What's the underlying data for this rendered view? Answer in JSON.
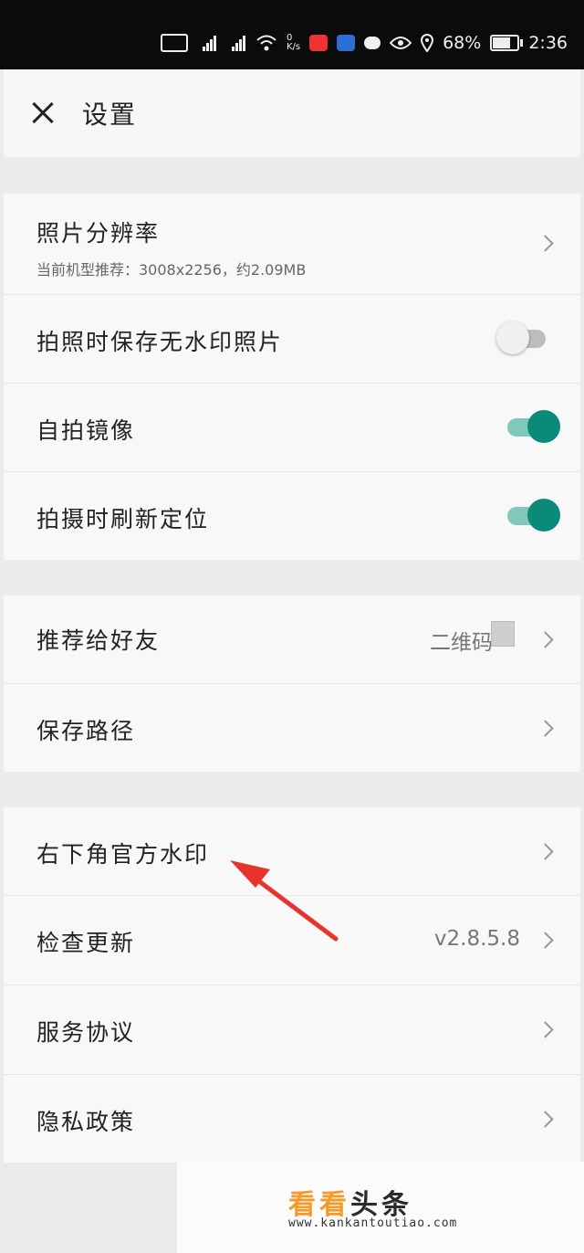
{
  "status_bar": {
    "network_speed": "0\nK/s",
    "battery_percent": "68%",
    "time": "2:36"
  },
  "header": {
    "title": "设置"
  },
  "settings": {
    "resolution": {
      "label": "照片分辨率",
      "subtitle": "当前机型推荐：3008x2256，约2.09MB"
    },
    "save_no_watermark": {
      "label": "拍照时保存无水印照片",
      "enabled": false
    },
    "selfie_mirror": {
      "label": "自拍镜像",
      "enabled": true
    },
    "refresh_location": {
      "label": "拍摄时刷新定位",
      "enabled": true
    },
    "recommend": {
      "label": "推荐给好友",
      "value": "二维码"
    },
    "save_path": {
      "label": "保存路径"
    },
    "official_watermark": {
      "label": "右下角官方水印"
    },
    "check_update": {
      "label": "检查更新",
      "value": "v2.8.5.8"
    },
    "service_agreement": {
      "label": "服务协议"
    },
    "privacy_policy": {
      "label": "隐私政策"
    }
  },
  "colors": {
    "toggle_on": "#0a8a78",
    "annotation_arrow": "#e8322c",
    "watermark_orange": "#f39a2b"
  },
  "watermark": {
    "brand_orange": "看看",
    "brand_dark": "头条",
    "url": "www.kankantoutiao.com"
  }
}
